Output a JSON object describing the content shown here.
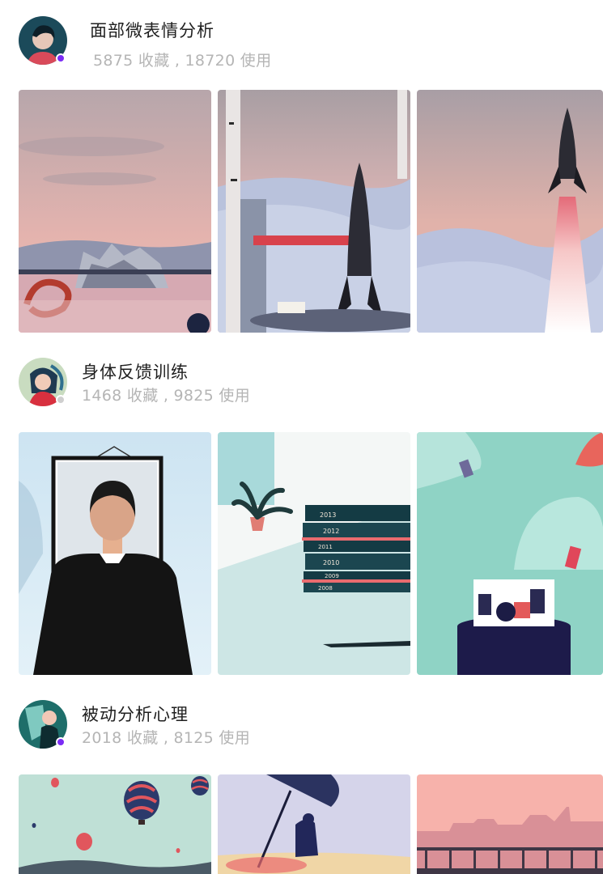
{
  "sections": [
    {
      "title": "面部微表情分析",
      "stats": "5875 收藏 , 18720 使用",
      "status_color": "#7b2cf5",
      "avatar_icon": "person-avatar-icon"
    },
    {
      "title": "身体反馈训练",
      "stats": "1468 收藏 , 9825 使用",
      "status_color": "#cfcfcf",
      "avatar_icon": "person-avatar-icon"
    },
    {
      "title": "被动分析心理",
      "stats": "2018 收藏 , 8125 使用",
      "status_color": "#7b2cf5",
      "avatar_icon": "person-avatar-icon"
    }
  ],
  "book_years": [
    "2013",
    "2012",
    "2011",
    "2010",
    "2009",
    "2008"
  ]
}
